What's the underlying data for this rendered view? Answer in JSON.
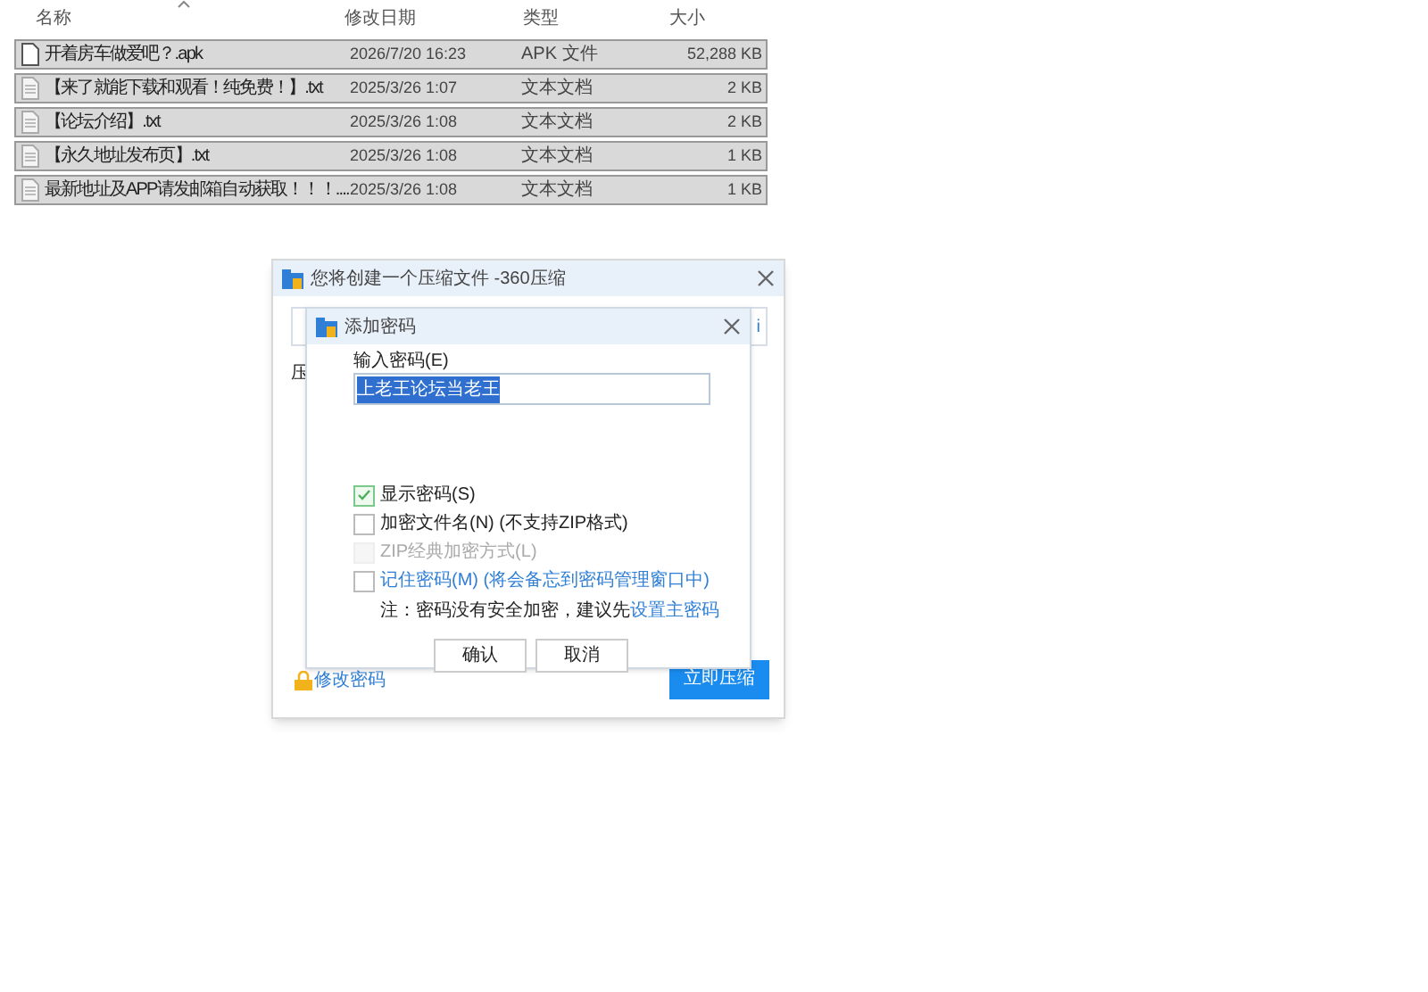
{
  "file_list": {
    "columns": [
      {
        "label": "名称",
        "sorted": true
      },
      {
        "label": "修改日期",
        "sorted": false
      },
      {
        "label": "类型",
        "sorted": false
      },
      {
        "label": "大小",
        "sorted": false
      }
    ],
    "rows": [
      {
        "kind": "apk",
        "name": "开着房车做爱吧？.apk",
        "date": "2026/7/20 16:23",
        "type": "APK 文件",
        "size": "52,288 KB",
        "selected": true
      },
      {
        "kind": "txt",
        "name": "【来了就能下载和观看！纯免费！】.txt",
        "date": "2025/3/26 1:07",
        "type": "文本文档",
        "size": "2 KB",
        "selected": true
      },
      {
        "kind": "txt",
        "name": "【论坛介绍】.txt",
        "date": "2025/3/26 1:08",
        "type": "文本文档",
        "size": "2 KB",
        "selected": true
      },
      {
        "kind": "txt",
        "name": "【永久地址发布页】.txt",
        "date": "2025/3/26 1:08",
        "type": "文本文档",
        "size": "1 KB",
        "selected": true
      },
      {
        "kind": "txt",
        "name": "最新地址及APP请发邮箱自动获取！！！....",
        "date": "2025/3/26 1:08",
        "type": "文本文档",
        "size": "1 KB",
        "selected": true
      }
    ]
  },
  "compress_dialog": {
    "title": "您将创建一个压缩文件 -360压缩",
    "field_edge": "i",
    "label_edge": "压",
    "change_password_link": "修改密码",
    "compress_button": "立即压缩"
  },
  "password_dialog": {
    "title": "添加密码",
    "input_label": "输入密码(E)",
    "password": "上老王论坛当老王",
    "password_selected": true,
    "options": [
      {
        "label": "显示密码(S)",
        "checked": true,
        "disabled": false,
        "link": false
      },
      {
        "label": "加密文件名(N) (不支持ZIP格式)",
        "checked": false,
        "disabled": false,
        "link": false
      },
      {
        "label": "ZIP经典加密方式(L)",
        "checked": false,
        "disabled": true,
        "link": false
      },
      {
        "label": "记住密码(M) (将会备忘到密码管理窗口中)",
        "checked": false,
        "disabled": false,
        "link": true
      }
    ],
    "note": "注：密码没有安全加密，建议先",
    "note_link": "设置主密码",
    "buttons": [
      "确认",
      "取消"
    ]
  }
}
